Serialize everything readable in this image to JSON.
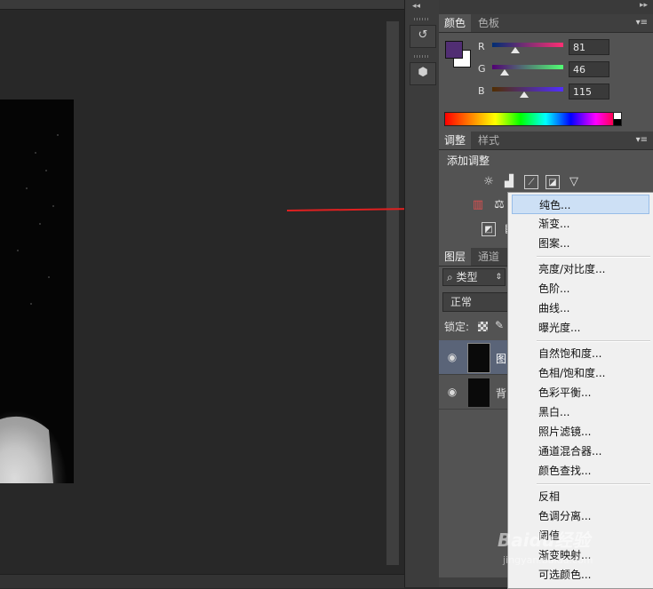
{
  "color_panel": {
    "tabs": [
      "颜色",
      "色板"
    ],
    "active_tab": 0,
    "foreground_color": "#51 2e 73",
    "foreground_hex": "#512e73",
    "background_hex": "#ffffff",
    "channels": [
      {
        "label": "R",
        "value": "81",
        "fraction": 0.32,
        "gradient": "linear-gradient(90deg,#002e73,#ff2e73)"
      },
      {
        "label": "G",
        "value": "46",
        "fraction": 0.18,
        "gradient": "linear-gradient(90deg,#510073,#51ff73)"
      },
      {
        "label": "B",
        "value": "115",
        "fraction": 0.45,
        "gradient": "linear-gradient(90deg,#512e00,#512eff)"
      }
    ]
  },
  "adjustments_panel": {
    "tabs": [
      "调整",
      "样式"
    ],
    "active_tab": 0,
    "heading": "添加调整"
  },
  "layers_panel": {
    "tabs": [
      "图层",
      "通道"
    ],
    "active_tab": 0,
    "filter_label": "类型",
    "blend_mode": "正常",
    "lock_label": "锁定:",
    "layers": [
      {
        "name_fragment": "图",
        "selected": true
      },
      {
        "name_fragment": "背",
        "selected": false
      }
    ]
  },
  "context_menu": {
    "groups": [
      [
        "纯色...",
        "渐变...",
        "图案..."
      ],
      [
        "亮度/对比度...",
        "色阶...",
        "曲线...",
        "曝光度..."
      ],
      [
        "自然饱和度...",
        "色相/饱和度...",
        "色彩平衡...",
        "黑白...",
        "照片滤镜...",
        "通道混合器...",
        "颜色查找..."
      ],
      [
        "反相",
        "色调分离...",
        "阈值",
        "渐变映射...",
        "可选颜色..."
      ]
    ],
    "highlighted": "纯色..."
  },
  "watermark": {
    "text": "Baidu经验",
    "sub": "jingyan.baidu.com"
  },
  "colors": {
    "annotation_arrow": "#e02020",
    "menu_highlight": "#cde0f5"
  }
}
